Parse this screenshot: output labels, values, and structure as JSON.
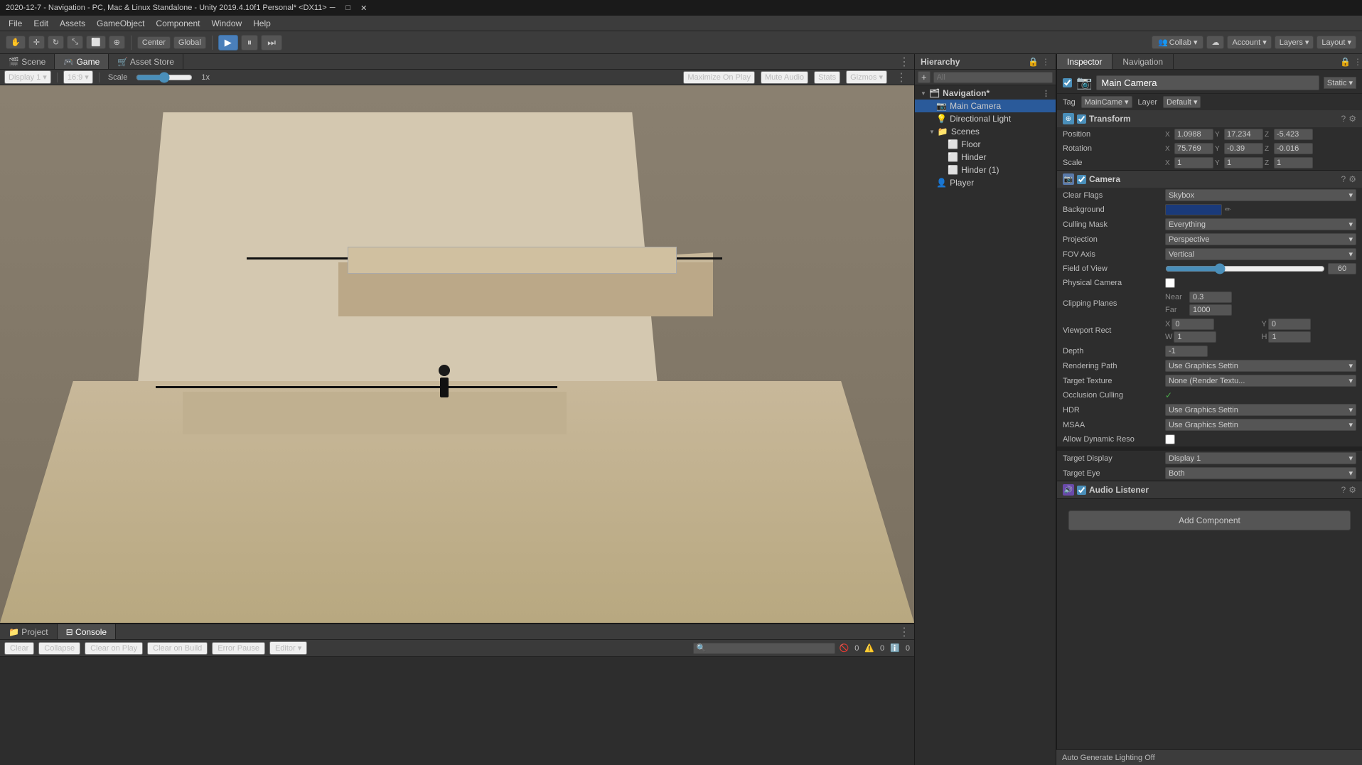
{
  "titlebar": {
    "title": "2020-12-7 - Navigation - PC, Mac & Linux Standalone - Unity 2019.4.10f1 Personal* <DX11>",
    "min_btn": "─",
    "max_btn": "□",
    "close_btn": "✕"
  },
  "menubar": {
    "items": [
      "File",
      "Edit",
      "Assets",
      "GameObject",
      "Component",
      "Window",
      "Help"
    ]
  },
  "toolbar": {
    "transform_tools": [
      "⊹",
      "↔",
      "↻",
      "⤡",
      "⬡",
      "⊕"
    ],
    "pivot_label": "Center",
    "space_label": "Global",
    "play_btn": "▶",
    "pause_btn": "⏸",
    "step_btn": "⏭",
    "collab_label": "Collab ▾",
    "cloud_icon": "☁",
    "account_label": "Account ▾",
    "layers_label": "Layers ▾",
    "layout_label": "Layout ▾"
  },
  "view_tabs": {
    "tabs": [
      "Scene",
      "Game",
      "Asset Store"
    ],
    "active": "Game"
  },
  "game_controls": {
    "display_label": "Display 1",
    "ratio_label": "16:9",
    "scale_label": "Scale",
    "scale_value": "1x",
    "maximize_label": "Maximize On Play",
    "mute_label": "Mute Audio",
    "stats_label": "Stats",
    "gizmos_label": "Gizmos ▾"
  },
  "console": {
    "tabs": [
      "Project",
      "Console"
    ],
    "active_tab": "Console",
    "buttons": [
      "Clear",
      "Collapse",
      "Clear on Play",
      "Clear on Build",
      "Error Pause",
      "Editor ▾"
    ],
    "error_count": "0",
    "warn_count": "0",
    "info_count": "0"
  },
  "hierarchy": {
    "title": "Hierarchy",
    "search_placeholder": "All",
    "items": [
      {
        "label": "Navigation*",
        "level": 0,
        "icon": "▼",
        "has_children": true
      },
      {
        "label": "Main Camera",
        "level": 1,
        "icon": "▷",
        "selected": true
      },
      {
        "label": "Directional Light",
        "level": 1,
        "icon": ""
      },
      {
        "label": "Scenes",
        "level": 1,
        "icon": "▼",
        "has_children": true
      },
      {
        "label": "Floor",
        "level": 2,
        "icon": ""
      },
      {
        "label": "Hinder",
        "level": 2,
        "icon": ""
      },
      {
        "label": "Hinder (1)",
        "level": 2,
        "icon": ""
      },
      {
        "label": "Player",
        "level": 1,
        "icon": ""
      }
    ]
  },
  "inspector": {
    "title": "Inspector",
    "navigation_tab": "Navigation",
    "object_name": "Main Camera",
    "static_label": "Static ▾",
    "tag_label": "Tag",
    "tag_value": "MainCame ▾",
    "layer_label": "Layer",
    "layer_value": "Default ▾",
    "transform": {
      "label": "Transform",
      "position": {
        "label": "Position",
        "x": "1.0988",
        "y": "17.234",
        "z": "-5.423"
      },
      "rotation": {
        "label": "Rotation",
        "x": "75.769",
        "y": "-0.39",
        "z": "-0.016"
      },
      "scale": {
        "label": "Scale",
        "x": "1",
        "y": "1",
        "z": "1"
      }
    },
    "camera": {
      "label": "Camera",
      "clear_flags_label": "Clear Flags",
      "clear_flags_value": "Skybox",
      "background_label": "Background",
      "culling_mask_label": "Culling Mask",
      "culling_mask_value": "Everything",
      "projection_label": "Projection",
      "projection_value": "Perspective",
      "fov_axis_label": "FOV Axis",
      "fov_axis_value": "Vertical",
      "fov_label": "Field of View",
      "fov_value": "60",
      "physical_camera_label": "Physical Camera",
      "clipping_planes_label": "Clipping Planes",
      "clipping_near_label": "Near",
      "clipping_near_value": "0.3",
      "clipping_far_label": "Far",
      "clipping_far_value": "1000",
      "viewport_rect_label": "Viewport Rect",
      "viewport_x": "0",
      "viewport_y": "0",
      "viewport_w": "1",
      "viewport_h": "1",
      "depth_label": "Depth",
      "depth_value": "-1",
      "rendering_path_label": "Rendering Path",
      "rendering_path_value": "Use Graphics Settin",
      "target_texture_label": "Target Texture",
      "target_texture_value": "None (Render Textu...",
      "occlusion_culling_label": "Occlusion Culling",
      "hdr_label": "HDR",
      "hdr_value": "Use Graphics Settin",
      "msaa_label": "MSAA",
      "msaa_value": "Use Graphics Settin",
      "dynamic_reso_label": "Allow Dynamic Reso",
      "target_display_label": "Target Display",
      "target_display_value": "Display 1",
      "target_eye_label": "Target Eye",
      "target_eye_value": "Both"
    },
    "audio_listener": {
      "label": "Audio Listener"
    },
    "add_component_label": "Add Component"
  },
  "statusbar": {
    "text": "Auto Generate Lighting Off"
  }
}
